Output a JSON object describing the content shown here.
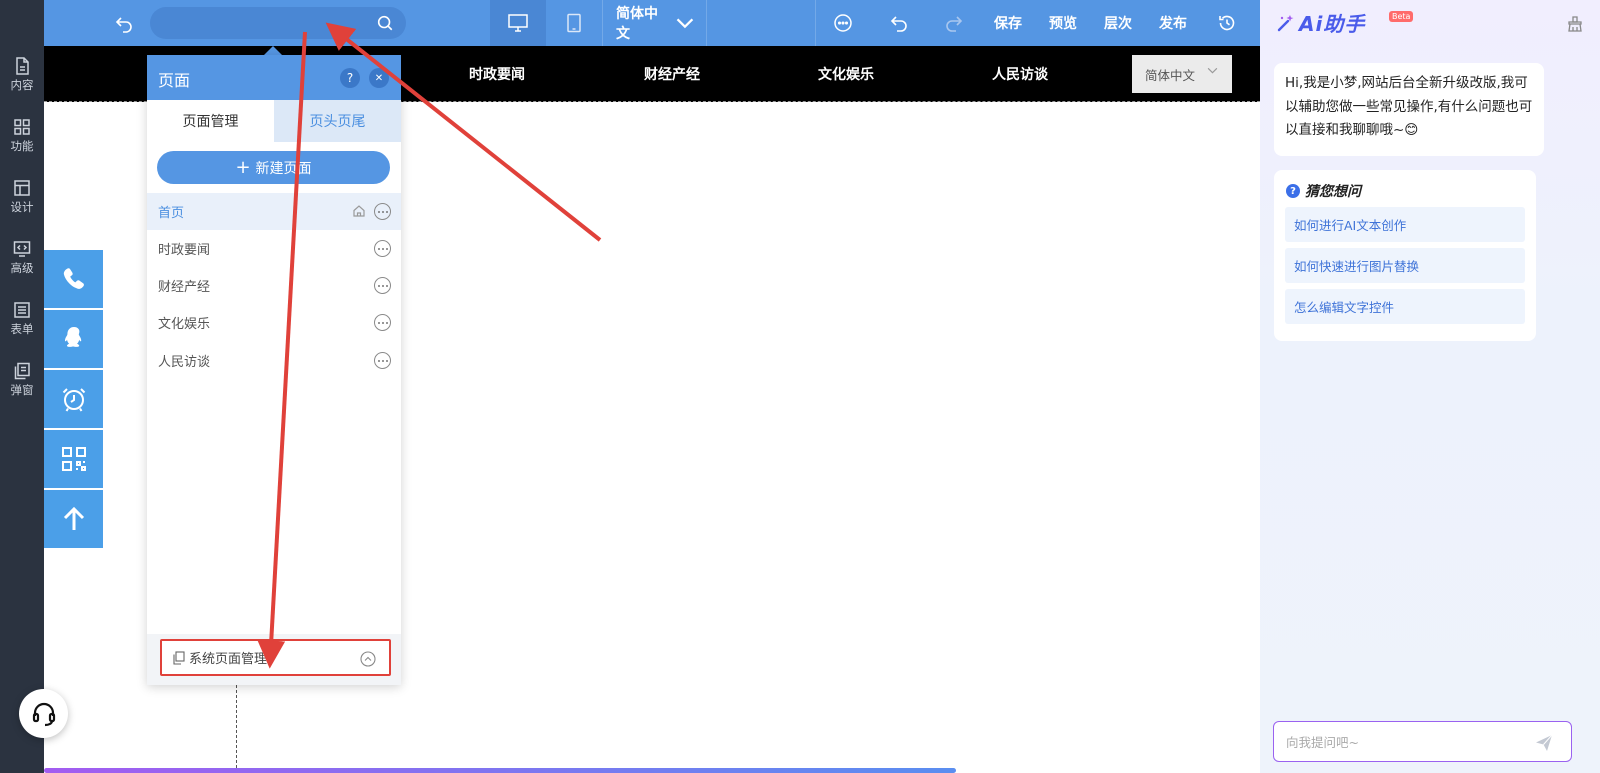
{
  "sidebar": {
    "items": [
      {
        "label": "内容",
        "icon": "document-icon"
      },
      {
        "label": "功能",
        "icon": "grid-icon"
      },
      {
        "label": "设计",
        "icon": "layout-icon"
      },
      {
        "label": "高级",
        "icon": "code-icon"
      },
      {
        "label": "表单",
        "icon": "form-icon"
      },
      {
        "label": "弹窗",
        "icon": "popup-icon"
      }
    ]
  },
  "toolbar": {
    "search_value": "",
    "language": "简体中文",
    "save": "保存",
    "preview": "预览",
    "layers": "层次",
    "publish": "发布"
  },
  "site_nav": {
    "links": [
      "时政要闻",
      "财经产经",
      "文化娱乐",
      "人民访谈"
    ],
    "language": "简体中文"
  },
  "page_panel": {
    "title": "页面",
    "help": "?",
    "close": "✕",
    "tabs": [
      "页面管理",
      "页头页尾"
    ],
    "new_page_plus": "+",
    "new_page": "新建页面",
    "pages": [
      "首页",
      "时政要闻",
      "财经产经",
      "文化娱乐",
      "人民访谈"
    ],
    "active_page": 0,
    "system_pages": "系统页面管理"
  },
  "canvas": {
    "progress_fraction": 0.75
  },
  "ai_assistant": {
    "title": "Ai助手",
    "badge": "Beta",
    "greeting": "Hi,我是小梦,网站后台全新升级改版,我可以辅助您做一些常见操作,有什么问题也可以直接和我聊聊哦~😊",
    "suggest_icon": "?",
    "suggest_title": "猜您想问",
    "suggestions": [
      "如何进行AI文本创作",
      "如何快速进行图片替换",
      "怎么编辑文字控件"
    ],
    "input_placeholder": "向我提问吧~"
  },
  "colors": {
    "toolbar_blue": "#5596e3",
    "sidebar_dark": "#2b3340",
    "widget_blue": "#4b9fe8",
    "annotation_red": "#e0413a",
    "ai_accent": "#4a5bea"
  }
}
